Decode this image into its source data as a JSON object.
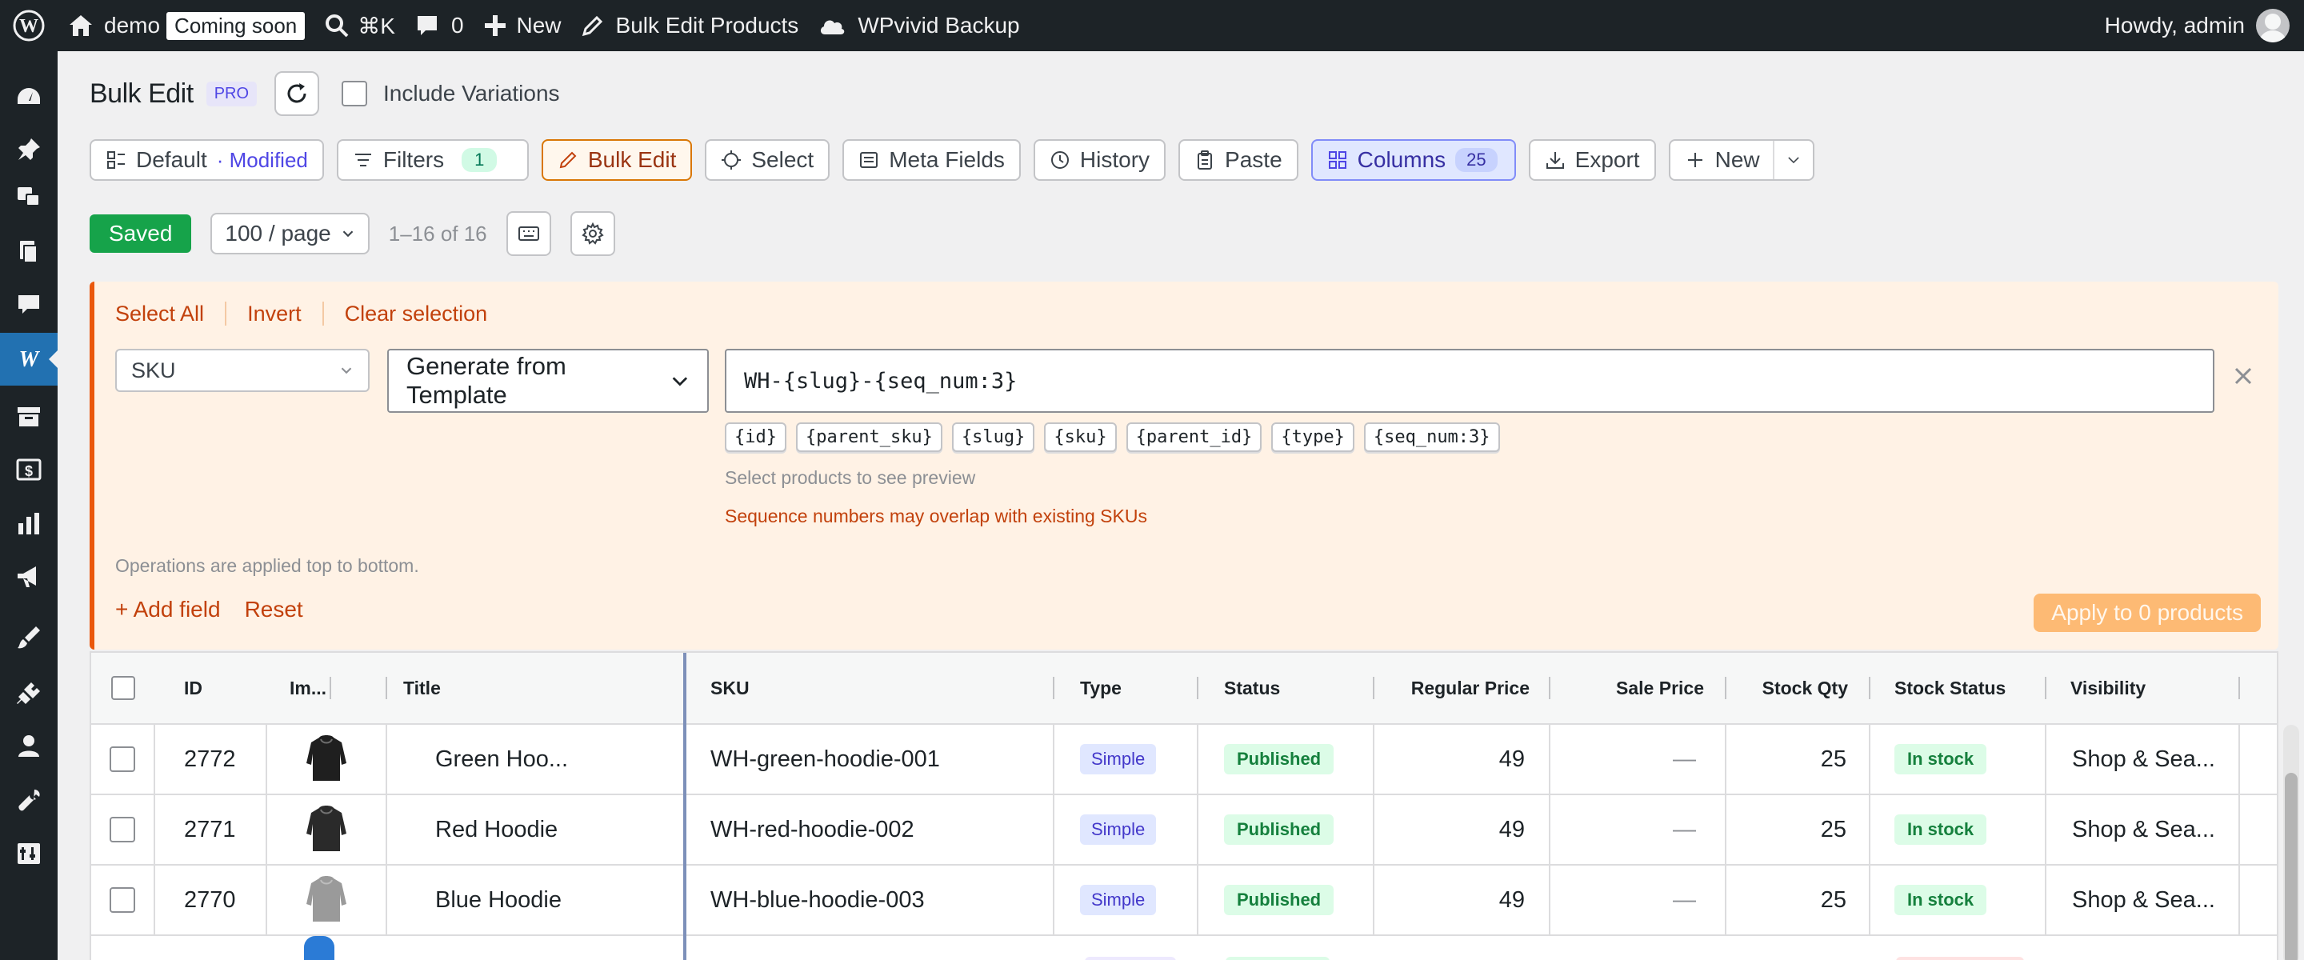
{
  "adminbar": {
    "site_name": "demo",
    "coming_soon": "Coming soon",
    "search_shortcut": "⌘K",
    "comments_count": "0",
    "new_label": "New",
    "bulk_edit_products": "Bulk Edit Products",
    "wpvivid_backup": "WPvivid Backup",
    "howdy": "Howdy, admin"
  },
  "header": {
    "title": "Bulk Edit",
    "badge": "PRO",
    "include_variations": "Include Variations"
  },
  "toolbar": {
    "default_label": "Default",
    "modified_label": "· Modified",
    "filters_label": "Filters",
    "filters_count": "1",
    "bulk_edit_label": "Bulk Edit",
    "select_label": "Select",
    "meta_fields_label": "Meta Fields",
    "history_label": "History",
    "paste_label": "Paste",
    "columns_label": "Columns",
    "columns_count": "25",
    "export_label": "Export",
    "new_label": "New"
  },
  "status_row": {
    "saved": "Saved",
    "per_page": "100 / page",
    "range": "1–16 of 16"
  },
  "bulk_panel": {
    "select_all": "Select All",
    "invert": "Invert",
    "clear_selection": "Clear selection",
    "field": "SKU",
    "operation": "Generate from Template",
    "template_value": "WH-{slug}-{seq_num:3}",
    "tokens": [
      "{id}",
      "{parent_sku}",
      "{slug}",
      "{sku}",
      "{parent_id}",
      "{type}",
      "{seq_num:3}"
    ],
    "preview_hint": "Select products to see preview",
    "warning": "Sequence numbers may overlap with existing SKUs",
    "ops_note": "Operations are applied top to bottom.",
    "add_field": "+ Add field",
    "reset": "Reset",
    "apply": "Apply to 0 products"
  },
  "table": {
    "headers": {
      "id": "ID",
      "image": "Im...",
      "title": "Title",
      "sku": "SKU",
      "type": "Type",
      "status": "Status",
      "regular_price": "Regular Price",
      "sale_price": "Sale Price",
      "stock_qty": "Stock Qty",
      "stock_status": "Stock Status",
      "visibility": "Visibility"
    },
    "rows": [
      {
        "id": "2772",
        "title": "Green Hoo...",
        "sku": "WH-green-hoodie-001",
        "type": "Simple",
        "status": "Published",
        "regular_price": "49",
        "sale_price": "—",
        "stock_qty": "25",
        "stock_status": "In stock",
        "visibility": "Shop & Sea...",
        "hoodie_color": "#1f1f1f"
      },
      {
        "id": "2771",
        "title": "Red Hoodie",
        "sku": "WH-red-hoodie-002",
        "type": "Simple",
        "status": "Published",
        "regular_price": "49",
        "sale_price": "—",
        "stock_qty": "25",
        "stock_status": "In stock",
        "visibility": "Shop & Sea...",
        "hoodie_color": "#2a2a2a"
      },
      {
        "id": "2770",
        "title": "Blue Hoodie",
        "sku": "WH-blue-hoodie-003",
        "type": "Simple",
        "status": "Published",
        "regular_price": "49",
        "sale_price": "—",
        "stock_qty": "25",
        "stock_status": "In stock",
        "visibility": "Shop & Sea...",
        "hoodie_color": "#9a9a9a"
      }
    ]
  },
  "colors": {
    "accent": "#4f46e5",
    "orange": "#ea580c",
    "green": "#16a34a",
    "adminbar": "#1d2327"
  }
}
